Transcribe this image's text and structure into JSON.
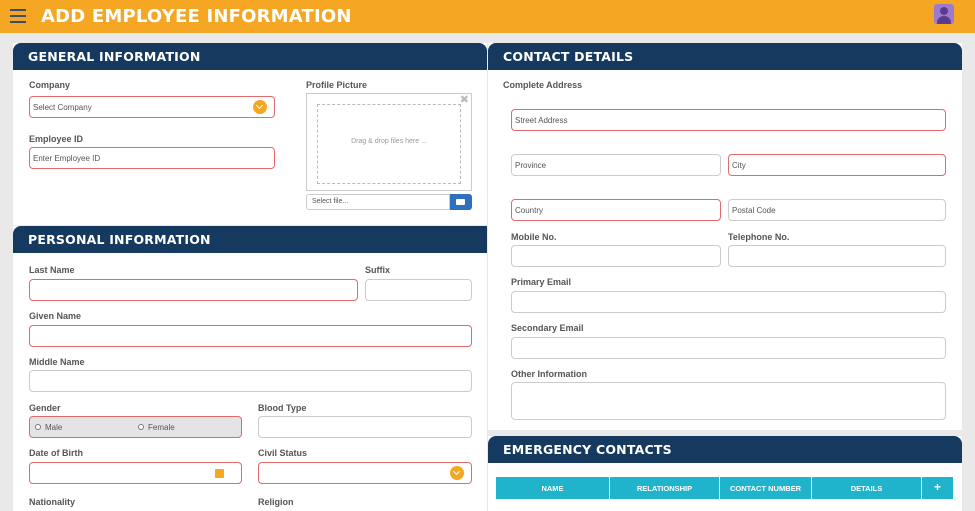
{
  "header": {
    "title": "ADD EMPLOYEE INFORMATION"
  },
  "general": {
    "heading": "GENERAL INFORMATION",
    "company_label": "Company",
    "company_value": "Select Company",
    "employee_id_label": "Employee ID",
    "employee_id_placeholder": "Enter Employee ID",
    "profile_picture_label": "Profile Picture",
    "dropzone_text": "Drag & drop files here ...",
    "file_placeholder": "Select file...",
    "close_glyph": "✖"
  },
  "personal": {
    "heading": "PERSONAL INFORMATION",
    "last_name_label": "Last Name",
    "suffix_label": "Suffix",
    "given_name_label": "Given Name",
    "middle_name_label": "Middle Name",
    "gender_label": "Gender",
    "gender_options": [
      "Male",
      "Female"
    ],
    "blood_type_label": "Blood Type",
    "dob_label": "Date of Birth",
    "civil_status_label": "Civil Status",
    "nationality_label": "Nationality",
    "religion_label": "Religion"
  },
  "contact": {
    "heading": "CONTACT DETAILS",
    "complete_address_label": "Complete Address",
    "street_placeholder": "Street Address",
    "province_placeholder": "Province",
    "city_placeholder": "City",
    "country_placeholder": "Country",
    "postal_placeholder": "Postal Code",
    "mobile_label": "Mobile No.",
    "telephone_label": "Telephone No.",
    "primary_email_label": "Primary Email",
    "secondary_email_label": "Secondary Email",
    "other_info_label": "Other Information"
  },
  "emergency": {
    "heading": "EMERGENCY CONTACTS",
    "columns": [
      "NAME",
      "RELATIONSHIP",
      "CONTACT NUMBER",
      "DETAILS"
    ],
    "add_glyph": "+"
  },
  "colors": {
    "accent": "#f5a623",
    "header": "#163a5f",
    "table_header": "#1fb3cc",
    "required_border": "#e36a6a"
  },
  "icons": [
    "menu-icon",
    "user-avatar-icon",
    "chevron-down-icon",
    "close-icon",
    "folder-open-icon",
    "calendar-icon",
    "plus-icon"
  ]
}
